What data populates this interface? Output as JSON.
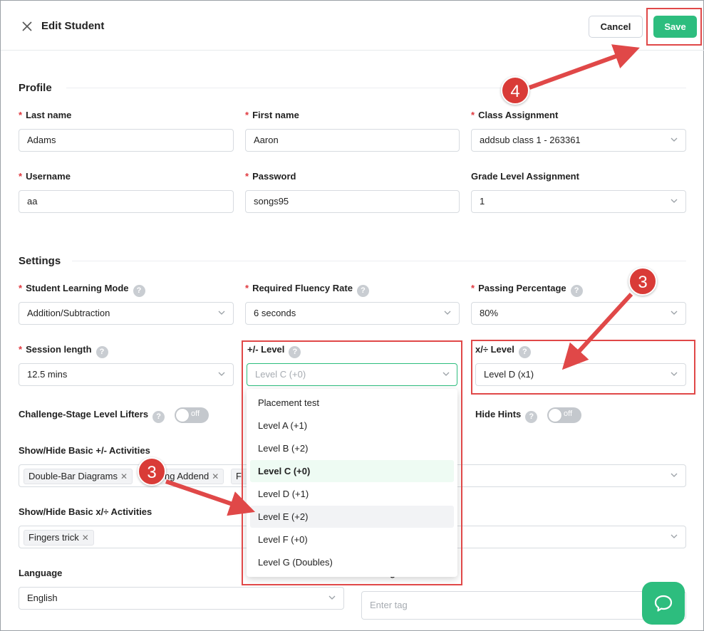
{
  "header": {
    "title": "Edit Student",
    "cancel_label": "Cancel",
    "save_label": "Save"
  },
  "profile": {
    "section_title": "Profile",
    "last_name": {
      "label": "Last name",
      "value": "Adams"
    },
    "first_name": {
      "label": "First name",
      "value": "Aaron"
    },
    "class_assignment": {
      "label": "Class Assignment",
      "value": "addsub class 1 - 263361"
    },
    "username": {
      "label": "Username",
      "value": "aa"
    },
    "password": {
      "label": "Password",
      "value": "songs95"
    },
    "grade_level": {
      "label": "Grade Level Assignment",
      "value": "1"
    }
  },
  "settings": {
    "section_title": "Settings",
    "learning_mode": {
      "label": "Student Learning Mode",
      "value": "Addition/Subtraction"
    },
    "fluency_rate": {
      "label": "Required Fluency Rate",
      "value": "6 seconds"
    },
    "passing_percentage": {
      "label": "Passing Percentage",
      "value": "80%"
    },
    "session_length": {
      "label": "Session length",
      "value": "12.5 mins"
    },
    "addsub_level": {
      "label": "+/- Level",
      "placeholder": "Level C (+0)"
    },
    "muldiv_level": {
      "label": "x/÷ Level",
      "value": "Level D (x1)"
    },
    "challenge_lifters": {
      "label": "Challenge-Stage Level Lifters",
      "state": "off"
    },
    "hide_hints": {
      "label": "Hide Hints",
      "state": "off"
    },
    "basic_addsub": {
      "label": "Show/Hide Basic +/- Activities",
      "tags": [
        "Double-Bar Diagrams",
        "ng Addend",
        "Fi"
      ]
    },
    "basic_muldiv": {
      "label": "Show/Hide Basic x/÷ Activities",
      "tags": [
        "Fingers trick"
      ]
    },
    "language": {
      "label": "Language",
      "value": "English"
    },
    "tags": {
      "label": "g",
      "placeholder": "Enter tag"
    }
  },
  "level_dropdown": {
    "options": [
      "Placement test",
      "Level A (+1)",
      "Level B (+2)",
      "Level C (+0)",
      "Level D (+1)",
      "Level E (+2)",
      "Level F (+0)",
      "Level G (Doubles)"
    ],
    "selected": "Level C (+0)",
    "hovered": "Level E (+2)"
  },
  "annotations": {
    "step_save": "4",
    "step_muldiv": "3",
    "step_option": "3"
  },
  "colors": {
    "accent": "#2dbd7e",
    "required": "#e0383e",
    "annotation_red": "#d93b37"
  },
  "icons": [
    "close-icon",
    "chevron-down-icon",
    "help-icon",
    "remove-tag-icon",
    "chat-icon"
  ]
}
